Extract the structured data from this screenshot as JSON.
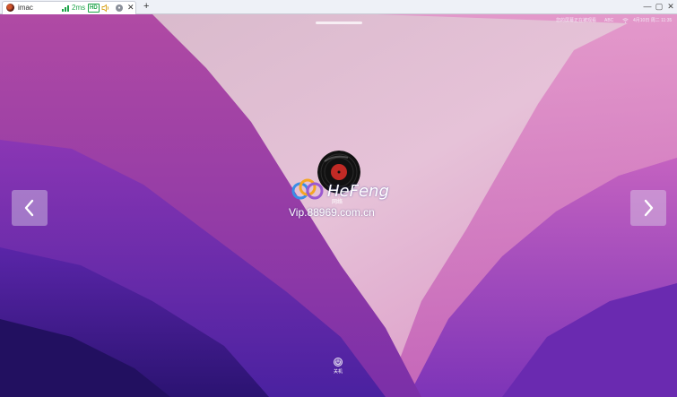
{
  "browser": {
    "tab": {
      "label": "imac",
      "close_glyph": "✕",
      "favicon": "vinyl-record-icon"
    },
    "status": {
      "ping": "2ms",
      "quality_badge": "HD"
    },
    "new_tab_glyph": "+",
    "window_controls": {
      "minimize": "—",
      "maximize": "▢",
      "close": "✕"
    }
  },
  "menubar": {
    "left_status": "您的屏幕正在被观看",
    "input_method": "ABC",
    "wifi_icon": "wifi-icon",
    "datetime": "4月10日 周二 11:35"
  },
  "lock_screen": {
    "user_name": "",
    "power_label": "关机",
    "nav": {
      "prev_icon": "chevron-left-icon",
      "next_icon": "chevron-right-icon"
    }
  },
  "watermark": {
    "brand": "HeFeng",
    "sub": "网络",
    "url": "Vip.88969.com.cn"
  },
  "colors": {
    "accent_green": "#1ea44a",
    "wallpaper_light": "#e8b4d6",
    "wallpaper_dark": "#3b1a8c"
  }
}
